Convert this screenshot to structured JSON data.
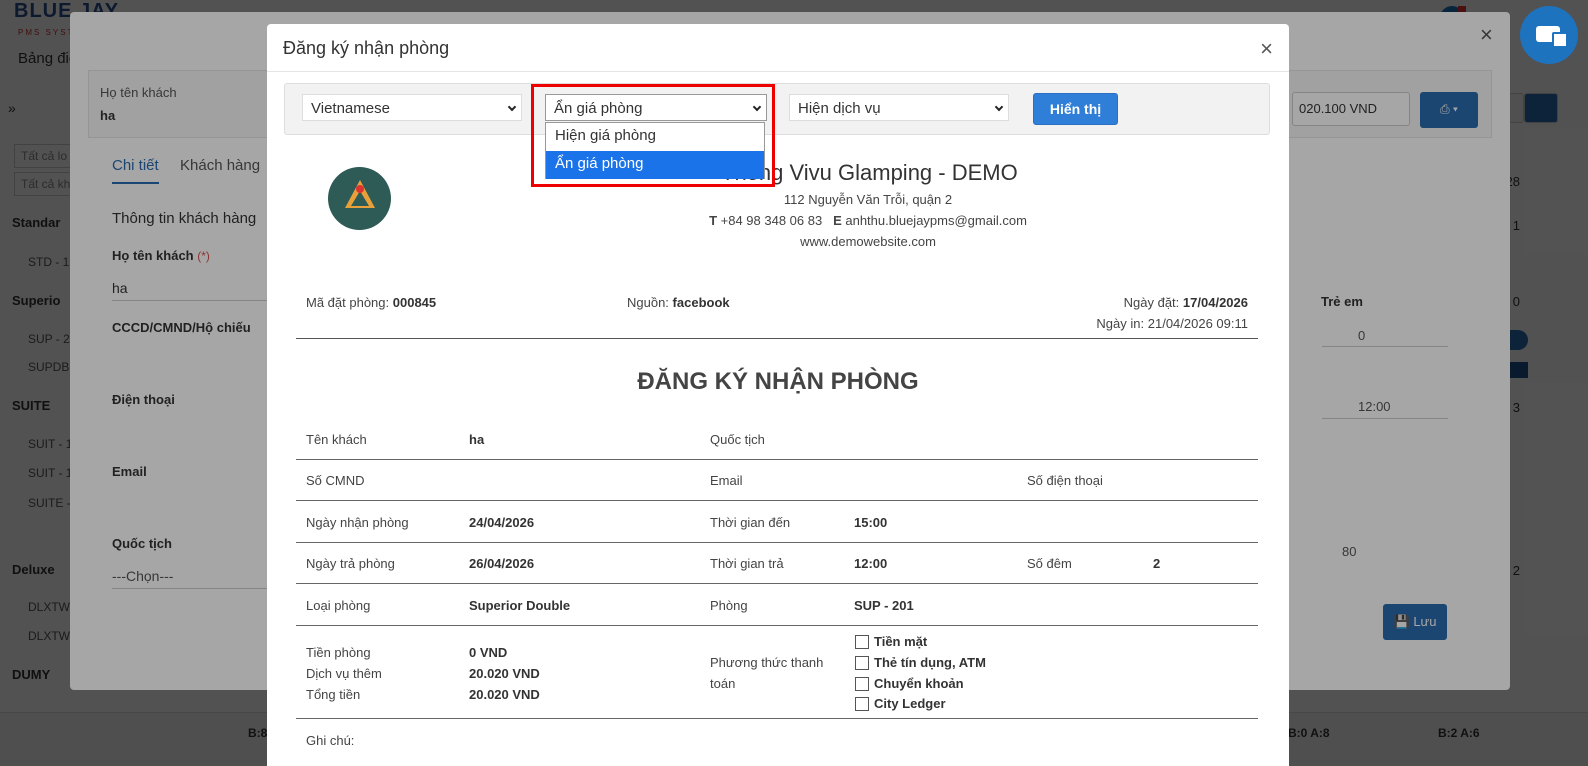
{
  "background": {
    "logo": "BLUE JAY",
    "logo_sub": "PMS SYSTEM",
    "nav_label": "Bảng điều",
    "filters": [
      "Tất cả lo",
      "Tất cả kh"
    ],
    "groups": [
      "Standar",
      "Superio",
      "SUITE",
      "Deluxe",
      "DUMY"
    ],
    "rooms": [
      "STD - 1",
      "SUP - 2",
      "SUPDBL",
      "SUIT - 1",
      "SUIT - 1",
      "SUITE -",
      "DLXTW",
      "DLXTW"
    ],
    "bottom_labels": [
      "B:8",
      "B:0 A:8",
      "B:2 A:6"
    ],
    "right_numbers": [
      "28",
      "1",
      "0",
      "3",
      "2"
    ]
  },
  "modal_behind": {
    "guest_label": "Họ tên khách",
    "guest_value": "ha",
    "tabs": [
      "Chi tiết",
      "Khách hàng"
    ],
    "section_title": "Thông tin khách hàng",
    "name_label": "Họ tên khách",
    "required_mark": "(*)",
    "name_value": "ha",
    "id_label": "CCCD/CMND/Hộ chiếu",
    "phone_label": "Điện thoại",
    "email_label": "Email",
    "nationality_label": "Quốc tịch",
    "nationality_value": "---Chọn---",
    "total_select": "020.100 VND",
    "children_label": "Trẻ em",
    "children_value": "0",
    "time_value": "12:00",
    "amount_value": "80",
    "save_label": "Lưu"
  },
  "modal": {
    "title": "Đăng ký nhận phòng",
    "close": "×",
    "toolbar": {
      "language": "Vietnamese",
      "price_mode": "Ẩn giá phòng",
      "service_mode": "Hiện dịch vụ",
      "show_button": "Hiển thị"
    },
    "dropdown_options": [
      "Hiện giá phòng",
      "Ẩn giá phòng"
    ],
    "hotel": {
      "name": "Thông Vivu Glamping - DEMO",
      "address": "112 Nguyễn Văn Trỗi, quận 2",
      "phone_prefix": "T",
      "phone": "+84 98 348 06 83",
      "email_prefix": "E",
      "email": "anhthu.bluejaypms@gmail.com",
      "website": "www.demowebsite.com"
    },
    "meta": {
      "booking_code_label": "Mã đặt phòng:",
      "booking_code": "000845",
      "source_label": "Nguồn:",
      "source": "facebook",
      "order_date_label": "Ngày đặt:",
      "order_date": "17/04/2026",
      "print_date_label": "Ngày in:",
      "print_date": "21/04/2026 09:11"
    },
    "doc_title": "ĐĂNG KÝ NHẬN PHÒNG",
    "rows": {
      "guest_name_label": "Tên khách",
      "guest_name": "ha",
      "nationality_label": "Quốc tịch",
      "id_label": "Số CMND",
      "email_label": "Email",
      "phone_label": "Số điện thoại",
      "checkin_label": "Ngày nhận phòng",
      "checkin": "24/04/2026",
      "arrival_label": "Thời gian đến",
      "arrival": "15:00",
      "checkout_label": "Ngày trả phòng",
      "checkout": "26/04/2026",
      "depart_label": "Thời gian trả",
      "depart": "12:00",
      "nights_label": "Số đêm",
      "nights": "2",
      "room_type_label": "Loại phòng",
      "room_type": "Superior Double",
      "room_label": "Phòng",
      "room": "SUP - 201",
      "room_price_label": "Tiền phòng",
      "room_price": "0 VND",
      "extra_label": "Dịch vụ thêm",
      "extra": "20.020 VND",
      "total_label": "Tổng tiền",
      "total": "20.020 VND",
      "payment_label_1": "Phương thức thanh",
      "payment_label_2": "toán",
      "payment_options": [
        "Tiền mặt",
        "Thẻ tín dụng, ATM",
        "Chuyển khoản",
        "City Ledger"
      ],
      "note_label": "Ghi chú:"
    }
  },
  "colors": {
    "accent": "#2f7fd8",
    "highlight": "#ee0000",
    "selected_option": "#1a73e8"
  }
}
